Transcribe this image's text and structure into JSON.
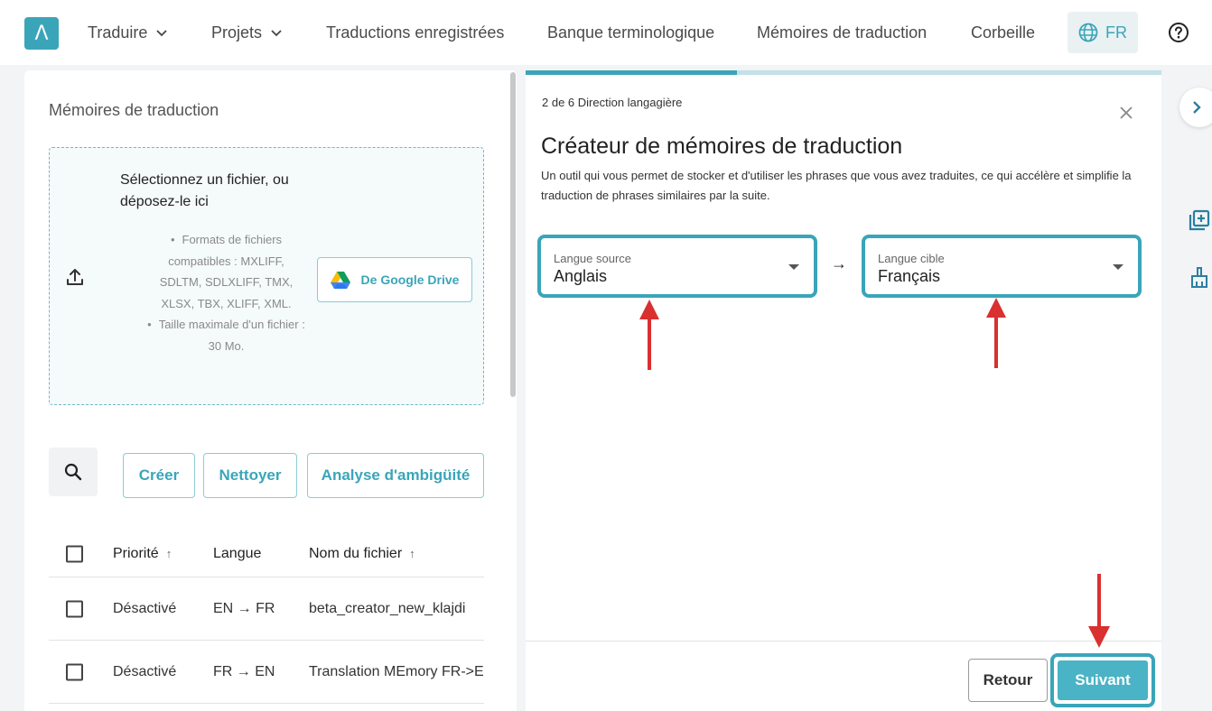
{
  "header": {
    "logo_glyph": "Λ",
    "nav": [
      {
        "label": "Traduire",
        "has_dropdown": true
      },
      {
        "label": "Projets",
        "has_dropdown": true
      },
      {
        "label": "Traductions enregistrées"
      },
      {
        "label": "Banque terminologique"
      },
      {
        "label": "Mémoires de traduction"
      },
      {
        "label": "Corbeille"
      }
    ],
    "chevron_glyph": "⌄",
    "language": "FR",
    "help_icon": "help-circle-icon"
  },
  "left": {
    "title": "Mémoires de traduction",
    "dropzone": {
      "title": "Sélectionnez un fichier, ou déposez-le ici",
      "formats": "Formats de fichiers compatibles : MXLIFF, SDLTM, SDLXLIFF, TMX, XLSX, TBX, XLIFF, XML.",
      "max_size": "Taille maximale d'un fichier : 30 Mo.",
      "gdrive_label": "De Google Drive"
    },
    "buttons": {
      "create": "Créer",
      "clean": "Nettoyer",
      "ambiguity": "Analyse d'ambigüité"
    },
    "table": {
      "headers": {
        "priority": "Priorité",
        "language": "Langue",
        "filename": "Nom du fichier"
      },
      "sort_glyph": "↑",
      "rows": [
        {
          "priority": "Désactivé",
          "language": "EN → FR",
          "filename": "beta_creator_new_klajdi"
        },
        {
          "priority": "Désactivé",
          "language": "FR → EN",
          "filename": "Translation MEmory FR->E"
        }
      ]
    }
  },
  "dialog": {
    "step": "2 de 6 Direction langagière",
    "progress": 0.333,
    "title": "Créateur de mémoires de traduction",
    "description": "Un outil qui vous permet de stocker et d'utiliser les phrases que vous avez traduites, ce qui accélère et simplifie la traduction de phrases similaires par la suite.",
    "source": {
      "label": "Langue source",
      "value": "Anglais"
    },
    "target": {
      "label": "Langue cible",
      "value": "Français"
    },
    "arrow_glyph": "→",
    "back_label": "Retour",
    "next_label": "Suivant"
  },
  "colors": {
    "accent": "#3aa5b9",
    "annotation_red": "#d93030"
  }
}
